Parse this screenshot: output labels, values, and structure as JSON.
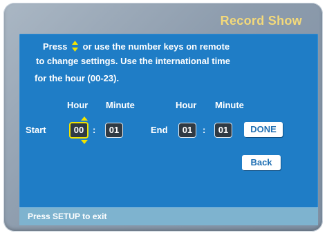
{
  "screen": {
    "title": "Record Show"
  },
  "instructions": {
    "line1_before": "Press",
    "line1_after": "or use the number keys on remote",
    "line2": "to change settings. Use the international time",
    "line3": "for the hour (00-23).",
    "arrow_icon": "up-down-arrows-icon"
  },
  "start": {
    "label": "Start",
    "hour_header": "Hour",
    "minute_header": "Minute",
    "hour_value": "00",
    "minute_value": "01",
    "separator": ":"
  },
  "end": {
    "label": "End",
    "hour_header": "Hour",
    "minute_header": "Minute",
    "hour_value": "01",
    "minute_value": "01",
    "separator": ":"
  },
  "buttons": {
    "done": "DONE",
    "back": "Back"
  },
  "footer": {
    "hint": "Press SETUP to exit"
  },
  "colors": {
    "panel": "#1f7dc6",
    "title": "#f3d97a",
    "focus": "#f2e400",
    "footer": "#7eb3cf"
  }
}
